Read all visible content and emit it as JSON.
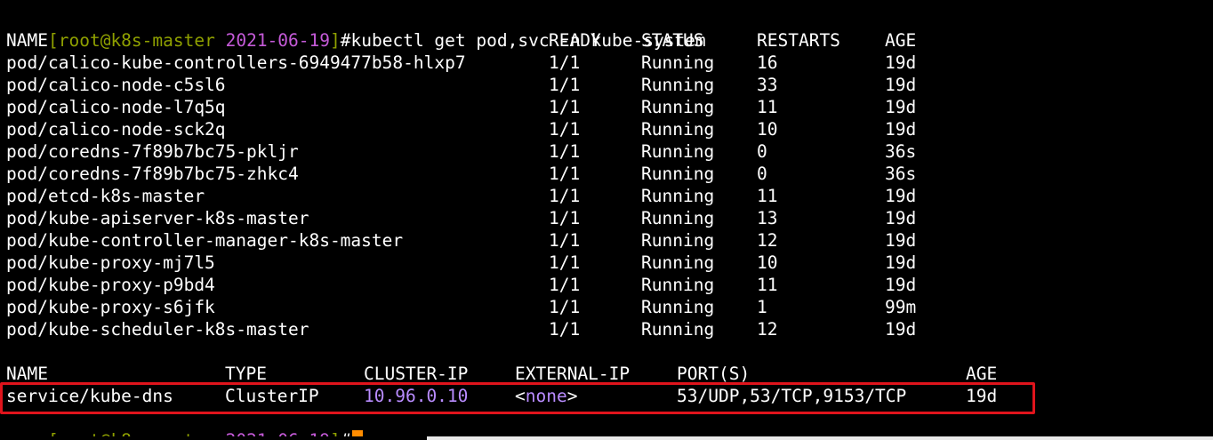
{
  "colors": {
    "background": "#000000",
    "foreground": "#ffffff",
    "prompt_green": "#8fa000",
    "prompt_magenta": "#c55ad8",
    "ip_purple": "#b98cff",
    "highlight_red": "#e0141c",
    "cursor_orange": "#ff8c00"
  },
  "prompt": {
    "open_bracket": "[",
    "user": "root",
    "at": "@",
    "host": "k8s-master",
    "dir": "2021-06-19",
    "close_bracket": "]",
    "hash": "#",
    "command": "kubectl get pod,svc -n kube-system"
  },
  "pods": {
    "headers": {
      "name": "NAME",
      "ready": "READY",
      "status": "STATUS",
      "restarts": "RESTARTS",
      "age": "AGE"
    },
    "rows": [
      {
        "name": "pod/calico-kube-controllers-6949477b58-hlxp7",
        "ready": "1/1",
        "status": "Running",
        "restarts": "16",
        "age": "19d"
      },
      {
        "name": "pod/calico-node-c5sl6",
        "ready": "1/1",
        "status": "Running",
        "restarts": "33",
        "age": "19d"
      },
      {
        "name": "pod/calico-node-l7q5q",
        "ready": "1/1",
        "status": "Running",
        "restarts": "11",
        "age": "19d"
      },
      {
        "name": "pod/calico-node-sck2q",
        "ready": "1/1",
        "status": "Running",
        "restarts": "10",
        "age": "19d"
      },
      {
        "name": "pod/coredns-7f89b7bc75-pkljr",
        "ready": "1/1",
        "status": "Running",
        "restarts": "0",
        "age": "36s"
      },
      {
        "name": "pod/coredns-7f89b7bc75-zhkc4",
        "ready": "1/1",
        "status": "Running",
        "restarts": "0",
        "age": "36s"
      },
      {
        "name": "pod/etcd-k8s-master",
        "ready": "1/1",
        "status": "Running",
        "restarts": "11",
        "age": "19d"
      },
      {
        "name": "pod/kube-apiserver-k8s-master",
        "ready": "1/1",
        "status": "Running",
        "restarts": "13",
        "age": "19d"
      },
      {
        "name": "pod/kube-controller-manager-k8s-master",
        "ready": "1/1",
        "status": "Running",
        "restarts": "12",
        "age": "19d"
      },
      {
        "name": "pod/kube-proxy-mj7l5",
        "ready": "1/1",
        "status": "Running",
        "restarts": "10",
        "age": "19d"
      },
      {
        "name": "pod/kube-proxy-p9bd4",
        "ready": "1/1",
        "status": "Running",
        "restarts": "11",
        "age": "19d"
      },
      {
        "name": "pod/kube-proxy-s6jfk",
        "ready": "1/1",
        "status": "Running",
        "restarts": "1",
        "age": "99m"
      },
      {
        "name": "pod/kube-scheduler-k8s-master",
        "ready": "1/1",
        "status": "Running",
        "restarts": "12",
        "age": "19d"
      }
    ]
  },
  "services": {
    "headers": {
      "name": "NAME",
      "type": "TYPE",
      "cluster_ip": "CLUSTER-IP",
      "external_ip": "EXTERNAL-IP",
      "ports": "PORT(S)",
      "age": "AGE"
    },
    "rows": [
      {
        "name": "service/kube-dns",
        "type": "ClusterIP",
        "cluster_ip": "10.96.0.10",
        "external_ip_open": "<",
        "external_ip_value": "none",
        "external_ip_close": ">",
        "ports": "53/UDP,53/TCP,9153/TCP",
        "age": "19d"
      }
    ]
  }
}
